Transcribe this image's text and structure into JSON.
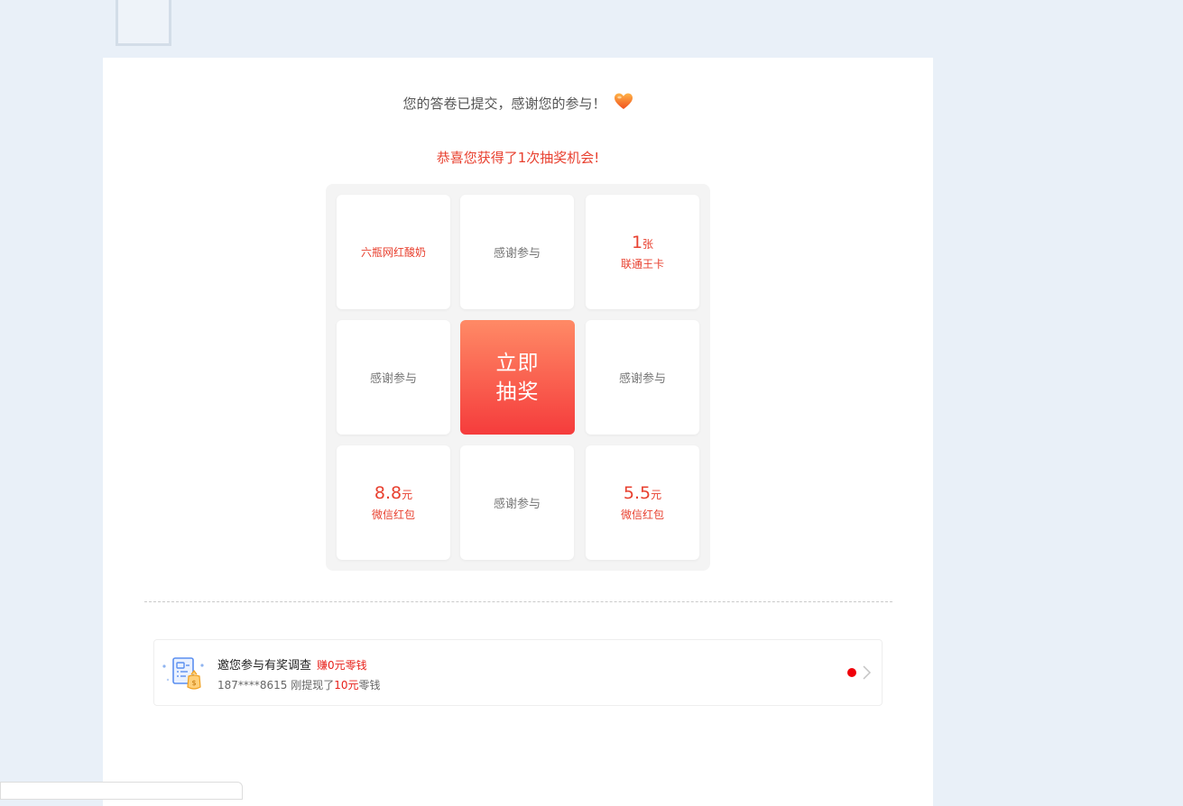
{
  "page": {
    "thanks_message": "您的答卷已提交，感谢您的参与！",
    "congrats_message": "恭喜您获得了1次抽奖机会!"
  },
  "lottery": {
    "draw_button_line1": "立即",
    "draw_button_line2": "抽奖",
    "cells": {
      "top_left": {
        "prize": "六瓶网红酸奶"
      },
      "top_center": {
        "text": "感谢参与"
      },
      "top_right": {
        "amount": "1",
        "unit": "张",
        "label": "联通王卡"
      },
      "mid_left": {
        "text": "感谢参与"
      },
      "mid_right": {
        "text": "感谢参与"
      },
      "bottom_left": {
        "amount": "8.8",
        "unit": "元",
        "label": "微信红包"
      },
      "bottom_center": {
        "text": "感谢参与"
      },
      "bottom_right": {
        "amount": "5.5",
        "unit": "元",
        "label": "微信红包"
      }
    }
  },
  "survey_banner": {
    "title": "邀您参与有奖调查",
    "earn_badge": "赚0元零钱",
    "desc_prefix": "187****8615 刚提现了",
    "desc_amount": "10元",
    "desc_suffix": "零钱",
    "icon": "survey-document-icon"
  },
  "colors": {
    "accent_red": "#e8402f",
    "draw_gradient_top": "#ff8a66",
    "draw_gradient_bottom": "#f53c3c",
    "page_bg": "#e9f0f8"
  }
}
